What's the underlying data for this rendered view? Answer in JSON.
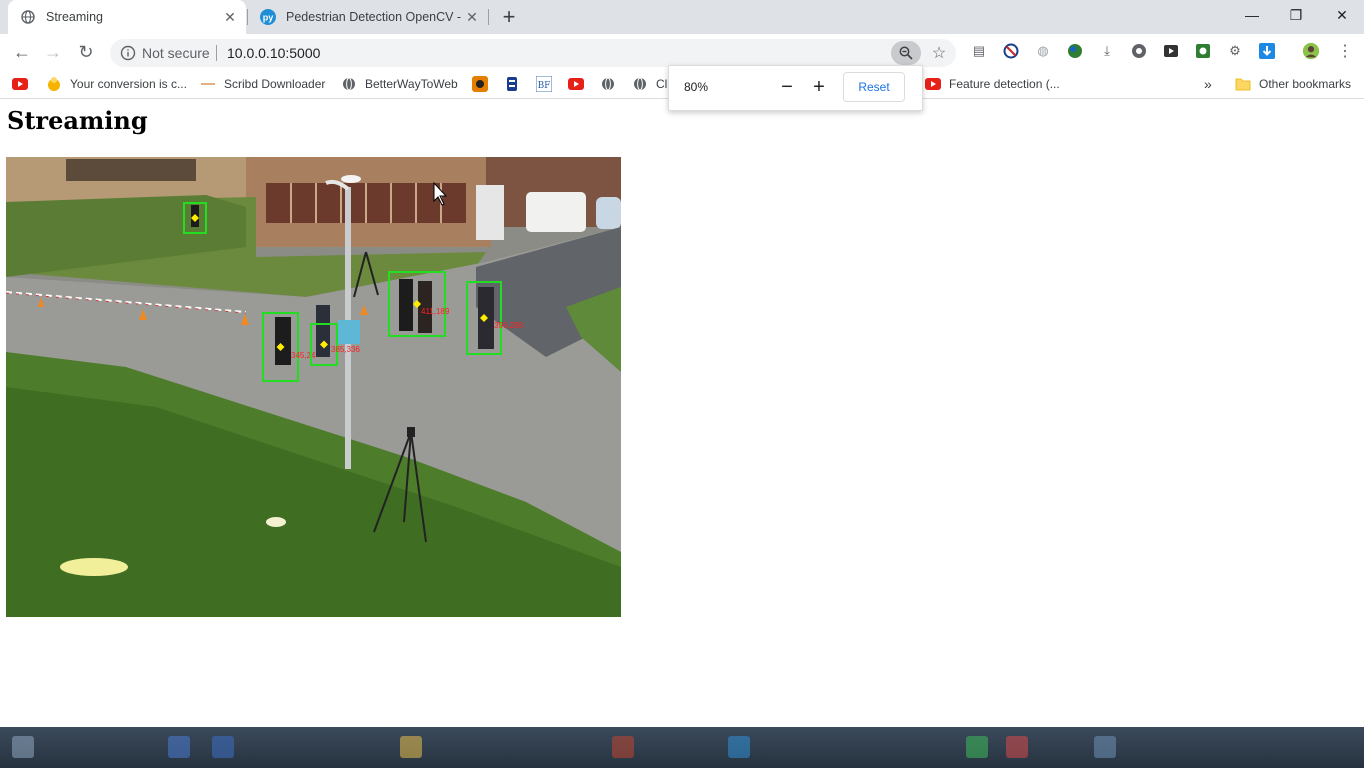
{
  "browser": {
    "tabs": [
      {
        "title": "Streaming",
        "active": true
      },
      {
        "title": "Pedestrian Detection OpenCV - P",
        "active": false
      }
    ],
    "new_tab": "+",
    "window": {
      "minimize": "—",
      "restore": "❐",
      "close": "✕"
    },
    "nav": {
      "back": "←",
      "forward": "→",
      "reload": "↻"
    },
    "security_label": "Not secure",
    "url": "10.0.0.10:5000",
    "bookmarks": [
      {
        "label": "",
        "icon": "youtube-icon"
      },
      {
        "label": "Your conversion is c...",
        "icon": "bookmark-favicon"
      },
      {
        "label": "Scribd Downloader",
        "icon": "bookmark-favicon"
      },
      {
        "label": "BetterWayToWeb",
        "icon": "globe-icon"
      },
      {
        "label": "",
        "icon": "bookmark-favicon"
      },
      {
        "label": "",
        "icon": "bookmark-favicon"
      },
      {
        "label": "",
        "icon": "bookmark-favicon"
      },
      {
        "label": "",
        "icon": "youtube-icon"
      },
      {
        "label": "",
        "icon": "globe-icon"
      },
      {
        "label": "Cl",
        "icon": "globe-icon"
      },
      {
        "label": "Feature detection (...",
        "icon": "youtube-icon"
      }
    ],
    "more_bookmarks": "»",
    "other_bookmarks": "Other bookmarks",
    "zoom_popup": {
      "value": "80%",
      "minus": "−",
      "plus": "+",
      "reset": "Reset"
    }
  },
  "page": {
    "heading": "Streaming",
    "detections": [
      {
        "label": "",
        "confidence": ""
      },
      {
        "label": "345,24",
        "confidence": ""
      },
      {
        "label": "385,336",
        "confidence": ""
      },
      {
        "label": "411,189",
        "confidence": ""
      },
      {
        "label": "396,208",
        "confidence": ""
      }
    ]
  },
  "colors": {
    "tabbar_bg": "#dee1e6",
    "omnibox_bg": "#f1f3f4",
    "accent_blue": "#1a73e8",
    "detection_box": "#22dd22",
    "detection_center": "#ffee00",
    "detection_label": "#ff2020"
  }
}
